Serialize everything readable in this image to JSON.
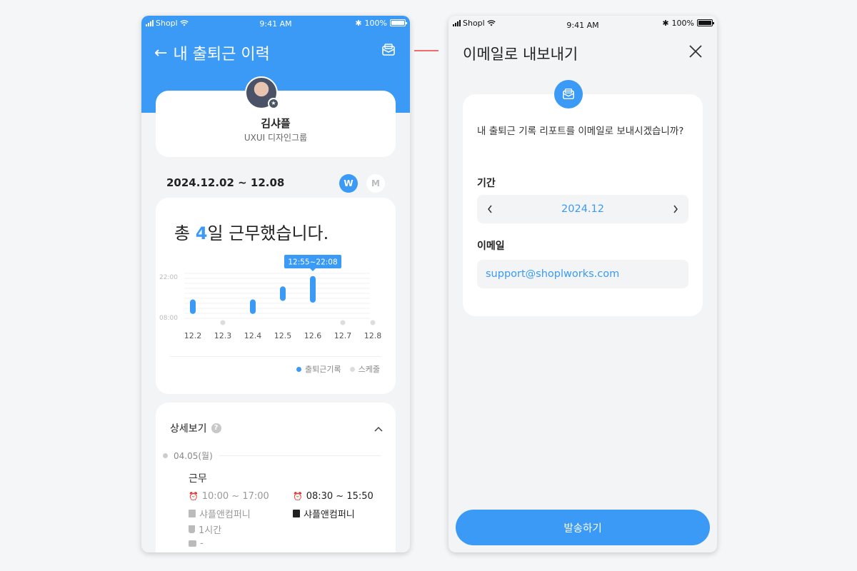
{
  "left": {
    "status": {
      "carrier": "Shopl",
      "time": "9:41 AM",
      "battery": "100%"
    },
    "header": {
      "back_label": "←",
      "title": "내 출퇴근 이력"
    },
    "profile": {
      "name": "김샤플",
      "team": "UXUI 디자인그룹"
    },
    "range": {
      "label": "2024.12.02 ~ 12.08",
      "toggle_week": "W",
      "toggle_month": "M"
    },
    "summary": {
      "prefix": "총",
      "count": "4",
      "suffix": "일 근무했습니다."
    },
    "chart_data": {
      "type": "bar",
      "categories": [
        "12.2",
        "12.3",
        "12.4",
        "12.5",
        "12.6",
        "12.7",
        "12.8"
      ],
      "y_tick_labels": [
        "22:00",
        "08:00"
      ],
      "ylim": [
        6,
        24
      ],
      "series": [
        {
          "name": "출퇴근기록",
          "color": "#3a9af5",
          "ranges": [
            [
              9,
              14
            ],
            null,
            [
              9,
              14
            ],
            [
              13.5,
              18.5
            ],
            [
              12.9,
              22.1
            ],
            null,
            null
          ]
        },
        {
          "name": "스케줄",
          "color": "#dddddd",
          "values": [
            null,
            6.5,
            null,
            null,
            null,
            6.5,
            6.5
          ]
        }
      ],
      "tooltip": {
        "category": "12.6",
        "label": "12:55~22:08"
      }
    },
    "legend": {
      "record": "출퇴근기록",
      "schedule": "스케줄"
    },
    "detail": {
      "title": "상세보기",
      "help": "?",
      "date": "04.05(월)",
      "work_label": "근무",
      "schedule_time": "10:00 ~ 17:00",
      "record_time": "08:30 ~ 15:50",
      "schedule_place": "샤플앤컴퍼니",
      "record_place": "샤플앤컴퍼니",
      "break_time": "1시간",
      "memo": "-"
    }
  },
  "right": {
    "status": {
      "carrier": "Shopl",
      "time": "9:41 AM",
      "battery": "100%"
    },
    "title": "이메일로 내보내기",
    "question": "내 출퇴근 기록 리포트를 이메일로 보내시겠습니까?",
    "period_label": "기간",
    "period_value": "2024.12",
    "email_label": "이메일",
    "email_value": "support@shoplworks.com",
    "send_label": "발송하기"
  },
  "colors": {
    "accent": "#3a9af5",
    "connector": "#f26a6a"
  }
}
